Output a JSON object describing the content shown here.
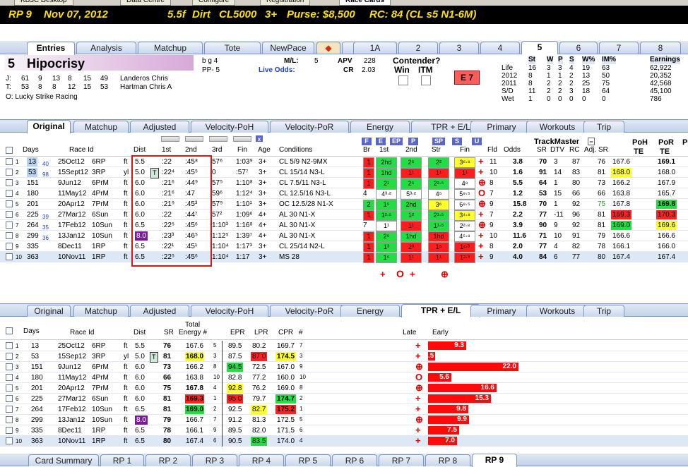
{
  "top_tabs": [
    "KB3C Desktop",
    "Data Centre",
    "Configure",
    "Registration",
    "Race Cards"
  ],
  "race": {
    "number": "RP 9",
    "date": "Nov 07, 2012",
    "distance": "5.5f",
    "surface": "Dirt",
    "class": "CL5000",
    "age": "3+",
    "purse": "Purse: $8,500",
    "rc": "RC: 84 (CL s5 N1-6M)"
  },
  "card_tabs": [
    "Entries",
    "Analysis",
    "Matchup",
    "Tote",
    "NewPace"
  ],
  "horse_tabs": [
    "1A",
    "2",
    "3",
    "4",
    "5",
    "6",
    "7",
    "8"
  ],
  "horse": {
    "num": "5",
    "name": "Hipocrisy",
    "sex_age": "b g 4",
    "pp": "PP- 5",
    "ml_label": "M/L:",
    "ml": "5",
    "live_odds": "Live Odds:",
    "apv_label": "APV",
    "apv": "228",
    "cr_label": "CR",
    "cr": "2.03",
    "contender": "Contender?",
    "win": "Win",
    "itm": "ITM",
    "e_rating": "E 7",
    "jockey": {
      "label": "J:",
      "stats": [
        "61",
        "9",
        "13",
        "8",
        "15",
        "49"
      ],
      "name": "Landeros Chris"
    },
    "trainer": {
      "label": "T:",
      "stats": [
        "53",
        "8",
        "8",
        "12",
        "15",
        "53"
      ],
      "name": "Hartman Chris A"
    },
    "owner": "O: Lucky Strike Racing"
  },
  "career": {
    "headers": [
      "St",
      "W",
      "P",
      "S",
      "W%",
      "IM%",
      "Earnings"
    ],
    "rows": [
      [
        "Life",
        "16",
        "3",
        "3",
        "4",
        "19",
        "63",
        "62,922"
      ],
      [
        "2012",
        "8",
        "1",
        "1",
        "2",
        "13",
        "50",
        "20,352"
      ],
      [
        "2011",
        "8",
        "2",
        "2",
        "2",
        "25",
        "75",
        "42,568"
      ],
      [
        "S/D",
        "11",
        "2",
        "2",
        "3",
        "18",
        "64",
        "45,100"
      ],
      [
        "Wet",
        "1",
        "0",
        "0",
        "0",
        "0",
        "0",
        "786"
      ]
    ]
  },
  "upper_tabs": [
    "Original",
    "Matchup",
    "Adjusted",
    "Velocity-PoH",
    "Velocity-PoR",
    "Energy",
    "TPR + E/L",
    "Primary",
    "Workouts",
    "Trip"
  ],
  "upper_headers": {
    "days": "Days",
    "race_id": "Race Id",
    "dist": "Dist",
    "first": "1st",
    "second": "2nd",
    "third": "3rd",
    "fin": "Fin",
    "age": "Age",
    "cond": "Conditions",
    "br": "Br",
    "c1": "1st",
    "c2": "2nd",
    "str": "Str",
    "fin2": "Fin",
    "fld": "Fld",
    "odds": "Odds",
    "tm": "TrackMaster",
    "sr": "SR",
    "dtv": "DTV",
    "rc": "RC",
    "adj": "Adj. SR",
    "poh": "PoH",
    "por": "PoR",
    "te": "TE",
    "te2": "TE",
    "p": "P"
  },
  "buttons_row": [
    "F",
    "E",
    "EP",
    "P",
    "SP",
    "S",
    "U"
  ],
  "upper_rows": [
    {
      "n": "1",
      "days": "13",
      "sp": "40",
      "date": "25Oct12",
      "rid": "6RP",
      "sfx": "ft",
      "dist": "5.5",
      "f1": ":22",
      "f2": ":45⁸",
      "f3": "57⁶",
      "fin": "1:03⁹",
      "age": "3+",
      "cond": "CL 5/9 N2-9MX",
      "br": "1",
      "b1": "2hd",
      "b2": "2⁵",
      "st": "2²",
      "fn": "3⁶⋅⁸",
      "fld": "11",
      "odds": "3.8",
      "sr": "70",
      "dtv": "3",
      "rc": "87",
      "adj": "76",
      "poh": "167.6",
      "por": "169.1",
      "mk": "+"
    },
    {
      "n": "2",
      "days": "53",
      "sp": "98",
      "date": "15Sept12",
      "rid": "3RP",
      "sfx": "yl",
      "dist": "5.0",
      "f1": ":22⁴",
      "f2": ":45⁵",
      "f3": "0",
      "fin": ":57⁷",
      "age": "3+",
      "cond": "CL 15/14 N3-L",
      "br": "1",
      "b1": "1hd",
      "b2": "1¹",
      "st": "1¹",
      "fn": "1¹",
      "fld": "10",
      "odds": "1.6",
      "sr": "91",
      "dtv": "14",
      "rc": "83",
      "adj": "81",
      "poh": "168.0",
      "por": "168.0",
      "mk": "+"
    },
    {
      "n": "3",
      "days": "151",
      "sp": "",
      "date": "9Jun12",
      "rid": "6PrM",
      "sfx": "ft",
      "dist": "6.0",
      "f1": ":21⁶",
      "f2": ":44⁹",
      "f3": "57⁵",
      "fin": "1:10⁸",
      "age": "3+",
      "cond": "CL 7.5/11 N3-L",
      "br": "1",
      "b1": "2¹",
      "b2": "2⁵",
      "st": "2²⋅⁵",
      "fn": "4⁸",
      "fld": "8",
      "odds": "5.5",
      "sr": "64",
      "dtv": "1",
      "rc": "80",
      "adj": "73",
      "poh": "166.2",
      "por": "167.9",
      "mk": "⊕"
    },
    {
      "n": "4",
      "days": "180",
      "sp": "",
      "date": "11May12",
      "rid": "4PrM",
      "sfx": "ft",
      "dist": "6.0",
      "f1": ":21⁶",
      "f2": ":47",
      "f3": "59⁶",
      "fin": "1:12⁴",
      "age": "3+",
      "cond": "CL 12.5/16 N3-L",
      "br": "4",
      "b1": "4³⋅²",
      "b2": "5³⋅²",
      "st": "4⁵",
      "fn": "5⁹⋅⁵",
      "fld": "7",
      "odds": "1.2",
      "sr": "53",
      "dtv": "15",
      "rc": "66",
      "adj": "66",
      "poh": "163.8",
      "por": "165.7",
      "mk": "O"
    },
    {
      "n": "5",
      "days": "201",
      "sp": "",
      "date": "20Apr12",
      "rid": "7PrM",
      "sfx": "ft",
      "dist": "6.0",
      "f1": ":21⁹",
      "f2": ":45³",
      "f3": "57⁹",
      "fin": "1:10¹",
      "age": "3+",
      "cond": "OC 12.5/28 N1-X",
      "br": "2",
      "b1": "1⁵",
      "b2": "2hd",
      "st": "3⁶",
      "fn": "6⁹⋅⁵",
      "fld": "9",
      "odds": "15.8",
      "sr": "70",
      "dtv": "1",
      "rc": "92",
      "adj": "75",
      "poh": "167.8",
      "por": "169.8",
      "mk": "⊕"
    },
    {
      "n": "6",
      "days": "225",
      "sp": "39",
      "date": "27Mar12",
      "rid": "6Sun",
      "sfx": "ft",
      "dist": "6.0",
      "f1": ":22",
      "f2": ":44⁷",
      "f3": "57²",
      "fin": "1:09⁶",
      "age": "4+",
      "cond": "AL 30 N1-X",
      "br": "1",
      "b1": "1²⋅⁵",
      "b2": "1²",
      "st": "2¹⋅⁵",
      "fn": "3⁴⋅⁸",
      "fld": "7",
      "odds": "2.2",
      "sr": "77",
      "dtv": "-11",
      "rc": "96",
      "adj": "81",
      "poh": "169.3",
      "por": "170.3",
      "mk": "+"
    },
    {
      "n": "7",
      "days": "264",
      "sp": "35",
      "date": "17Feb12",
      "rid": "10Sun",
      "sfx": "ft",
      "dist": "6.5",
      "f1": ":22⁵",
      "f2": ":45⁶",
      "f3": "1:10³",
      "fin": "1:16⁸",
      "age": "4+",
      "cond": "AL 30 N1-X",
      "br": "7",
      "b1": "1¹",
      "b2": "1¹",
      "st": "1¹⋅⁵",
      "fn": "2²⋅⁸",
      "fld": "9",
      "odds": "3.9",
      "sr": "90",
      "dtv": "9",
      "rc": "92",
      "adj": "81",
      "poh": "169.0",
      "por": "169.6",
      "mk": "⊕"
    },
    {
      "n": "8",
      "days": "299",
      "sp": "36",
      "date": "13Jan12",
      "rid": "10Sun",
      "sfx": "ft",
      "dist": "8.0",
      "f1": ":23³",
      "f2": ":46⁵",
      "f3": "1:12⁵",
      "fin": "1:39⁷",
      "age": "4+",
      "cond": "AL 30 N1-X",
      "br": "1",
      "b1": "2⁵",
      "b2": "1hd",
      "st": "1hd",
      "fn": "4⁵⋅⁸",
      "fld": "10",
      "odds": "11.6",
      "sr": "71",
      "dtv": "10",
      "rc": "91",
      "adj": "79",
      "poh": "166.6",
      "por": "166.6",
      "mk": "+"
    },
    {
      "n": "9",
      "days": "335",
      "sp": "",
      "date": "8Dec11",
      "rid": "1RP",
      "sfx": "ft",
      "dist": "6.5",
      "f1": ":22¹",
      "f2": ":45¹",
      "f3": "1:10⁴",
      "fin": "1:17³",
      "age": "3+",
      "cond": "CL 25/14 N2-L",
      "br": "1",
      "b1": "1³",
      "b2": "2³",
      "st": "1⁵",
      "fn": "1²⋅³",
      "fld": "8",
      "odds": "2.0",
      "sr": "77",
      "dtv": "4",
      "rc": "82",
      "adj": "78",
      "poh": "166.1",
      "por": "166.0",
      "mk": "+"
    },
    {
      "n": "10",
      "days": "363",
      "sp": "",
      "date": "10Nov11",
      "rid": "1RP",
      "sfx": "ft",
      "dist": "6.5",
      "f1": ":22⁵",
      "f2": ":45⁶",
      "f3": "1:10⁴",
      "fin": "1:17",
      "age": "3+",
      "cond": "MS 28",
      "br": "1",
      "b1": "1⁵",
      "b2": "1¹",
      "st": "1¹",
      "fn": "1²⋅³",
      "fld": "9",
      "odds": "4.0",
      "sr": "84",
      "dtv": "6",
      "rc": "77",
      "adj": "80",
      "poh": "167.4",
      "por": "167.4",
      "mk": "+"
    }
  ],
  "summary_marks": [
    "+",
    "O",
    "+",
    "⊕"
  ],
  "lower_tabs": [
    "Original",
    "Matchup",
    "Adjusted",
    "Velocity-PoH",
    "Velocity-PoR",
    "Energy",
    "TPR + E/L",
    "Primary",
    "Workouts",
    "Trip"
  ],
  "lower_headers": {
    "days": "Days",
    "race_id": "Race Id",
    "dist": "Dist",
    "sr": "SR",
    "total": "Total",
    "energy": "Energy #",
    "epr": "EPR",
    "lpr": "LPR",
    "cpr": "CPR",
    "hash": "#",
    "late": "Late",
    "early": "Early"
  },
  "lower_rows": [
    {
      "n": "1",
      "days": "13",
      "date": "25Oct12",
      "rid": "6RP",
      "sfx": "ft",
      "dist": "5.5",
      "sr": "76",
      "energy": "167.6",
      "er": "5",
      "epr": "89.5",
      "lpr": "80.2",
      "cpr": "169.7",
      "cr": "7",
      "mk": "+",
      "early": 9.3,
      "early_label": "9.3"
    },
    {
      "n": "2",
      "days": "53",
      "date": "15Sep12",
      "rid": "3RP",
      "sfx": "yl",
      "dist": "5.0",
      "sr": "81",
      "energy": "168.0",
      "er": "3",
      "epr": "87.5",
      "lpr": "87.0",
      "cpr": "174.5",
      "cr": "3",
      "mk": "+",
      "early": 0.5,
      "early_label": ".5"
    },
    {
      "n": "3",
      "days": "151",
      "date": "9Jun12",
      "rid": "6PrM",
      "sfx": "ft",
      "dist": "6.0",
      "sr": "73",
      "energy": "166.2",
      "er": "8",
      "epr": "94.5",
      "lpr": "72.5",
      "cpr": "167.0",
      "cr": "9",
      "mk": "⊕",
      "early": 22.0,
      "early_label": "22.0"
    },
    {
      "n": "4",
      "days": "180",
      "date": "11May12",
      "rid": "4PrM",
      "sfx": "ft",
      "dist": "6.0",
      "sr": "66",
      "energy": "163.8",
      "er": "10",
      "epr": "82.8",
      "lpr": "77.2",
      "cpr": "160.0",
      "cr": "10",
      "mk": "O",
      "early": 5.6,
      "early_label": "5.6"
    },
    {
      "n": "5",
      "days": "201",
      "date": "20Apr12",
      "rid": "7PrM",
      "sfx": "ft",
      "dist": "6.0",
      "sr": "75",
      "energy": "167.8",
      "er": "4",
      "epr": "92.8",
      "lpr": "76.2",
      "cpr": "169.0",
      "cr": "8",
      "mk": "⊕",
      "early": 16.6,
      "early_label": "16.6"
    },
    {
      "n": "6",
      "days": "225",
      "date": "27Mar12",
      "rid": "6Sun",
      "sfx": "ft",
      "dist": "6.0",
      "sr": "81",
      "energy": "169.3",
      "er": "1",
      "epr": "95.0",
      "lpr": "79.7",
      "cpr": "174.7",
      "cr": "2",
      "mk": "+",
      "early": 15.3,
      "early_label": "15.3"
    },
    {
      "n": "7",
      "days": "264",
      "date": "17Feb12",
      "rid": "10Sun",
      "sfx": "ft",
      "dist": "6.5",
      "sr": "81",
      "energy": "169.0",
      "er": "2",
      "epr": "92.5",
      "lpr": "82.7",
      "cpr": "175.2",
      "cr": "1",
      "mk": "+",
      "early": 9.8,
      "early_label": "9.8"
    },
    {
      "n": "8",
      "days": "299",
      "date": "13Jan12",
      "rid": "10Sun",
      "sfx": "ft",
      "dist": "8.0",
      "sr": "79",
      "energy": "166.7",
      "er": "7",
      "epr": "91.2",
      "lpr": "81.3",
      "cpr": "172.5",
      "cr": "5",
      "mk": "⊕",
      "early": 9.9,
      "early_label": "9.9"
    },
    {
      "n": "9",
      "days": "335",
      "date": "8Dec11",
      "rid": "1RP",
      "sfx": "ft",
      "dist": "6.5",
      "sr": "78",
      "energy": "166.1",
      "er": "9",
      "epr": "89.5",
      "lpr": "82.0",
      "cpr": "171.5",
      "cr": "6",
      "mk": "+",
      "early": 7.5,
      "early_label": "7.5"
    },
    {
      "n": "10",
      "days": "363",
      "date": "10Nov11",
      "rid": "1RP",
      "sfx": "ft",
      "dist": "6.5",
      "sr": "80",
      "energy": "167.4",
      "er": "6",
      "epr": "90.5",
      "lpr": "83.5",
      "cpr": "174.0",
      "cr": "4",
      "mk": "+",
      "early": 7.0,
      "early_label": "7.0"
    }
  ],
  "bottom_tabs": [
    "Card Summary",
    "RP 1",
    "RP 2",
    "RP 3",
    "RP 4",
    "RP 5",
    "RP 6",
    "RP 7",
    "RP 8",
    "RP 9"
  ]
}
